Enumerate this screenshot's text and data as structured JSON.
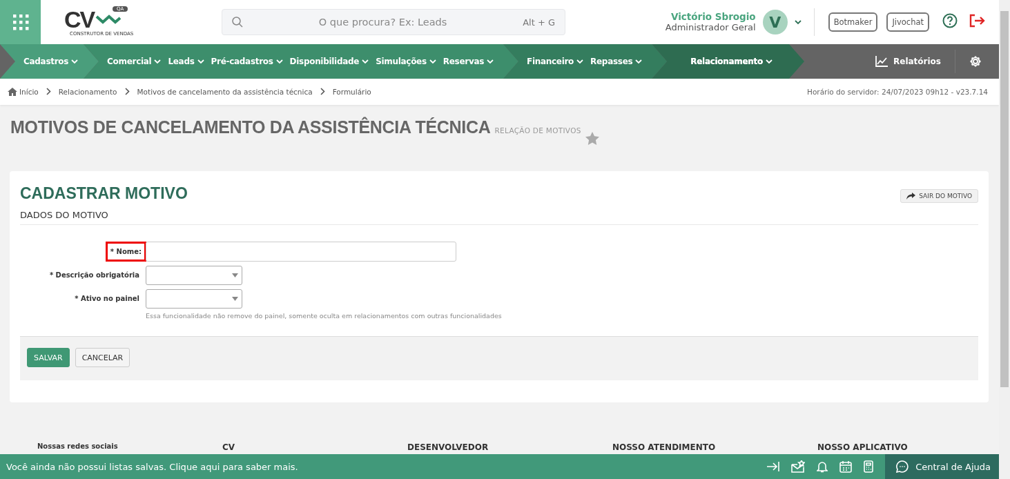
{
  "header": {
    "logo": {
      "mark": "CV",
      "badge": "QA",
      "tagline": "CONSTRUTOR DE VENDAS"
    },
    "search": {
      "placeholder": "O que procura? Ex: Leads",
      "shortcut": "Alt + G"
    },
    "user": {
      "name": "Victório Sbrogio",
      "role": "Administrador Geral",
      "initial": "V"
    },
    "buttons": [
      "Botmaker",
      "Jivochat"
    ]
  },
  "nav": {
    "groups": [
      {
        "items": [
          {
            "label": "Cadastros",
            "selected": false
          }
        ]
      },
      {
        "items": [
          {
            "label": "Comercial",
            "selected": false
          },
          {
            "label": "Leads",
            "selected": false
          },
          {
            "label": "Pré-cadastros",
            "selected": false
          },
          {
            "label": "Disponibilidade",
            "selected": false
          },
          {
            "label": "Simulações",
            "selected": false
          },
          {
            "label": "Reservas",
            "selected": false
          }
        ]
      },
      {
        "items": [
          {
            "label": "Financeiro",
            "selected": false
          },
          {
            "label": "Repasses",
            "selected": false
          }
        ]
      },
      {
        "items": [
          {
            "label": "Relacionamento",
            "selected": true
          }
        ]
      }
    ],
    "reports": "Relatórios"
  },
  "breadcrumb": {
    "items": [
      "Início",
      "Relacionamento",
      "Motivos de cancelamento da assistência técnica",
      "Formulário"
    ],
    "server_time": "Horário do servidor: 24/07/2023 09h12 - v23.7.14"
  },
  "page": {
    "title": "MOTIVOS DE CANCELAMENTO DA ASSISTÊNCIA TÉCNICA",
    "subtitle": "RELAÇÃO DE MOTIVOS"
  },
  "form": {
    "title": "CADASTRAR MOTIVO",
    "exit_button": "SAIR DO MOTIVO",
    "section": "DADOS DO MOTIVO",
    "fields": [
      {
        "kind": "text",
        "label": "* Nome:",
        "highlighted": true
      },
      {
        "kind": "select",
        "label": "* Descrição obrigatória",
        "highlighted": false
      },
      {
        "kind": "select",
        "label": "* Ativo no painel",
        "highlighted": false,
        "help": "Essa funcionalidade não remove do painel, somente oculta em relacionamentos com outras funcionalidades"
      }
    ],
    "buttons": [
      {
        "label": "SALVAR",
        "kind": "primary"
      },
      {
        "label": "CANCELAR",
        "kind": "default"
      }
    ]
  },
  "footer": {
    "social": "Nossas redes sociais",
    "columns": [
      "CV",
      "DESENVOLVEDOR",
      "NOSSO ATENDIMENTO",
      "NOSSO APLICATIVO"
    ]
  },
  "bottom_bar": {
    "message": "Você ainda não possui listas salvas. Clique aqui para saber mais.",
    "help": "Central de Ajuda"
  }
}
